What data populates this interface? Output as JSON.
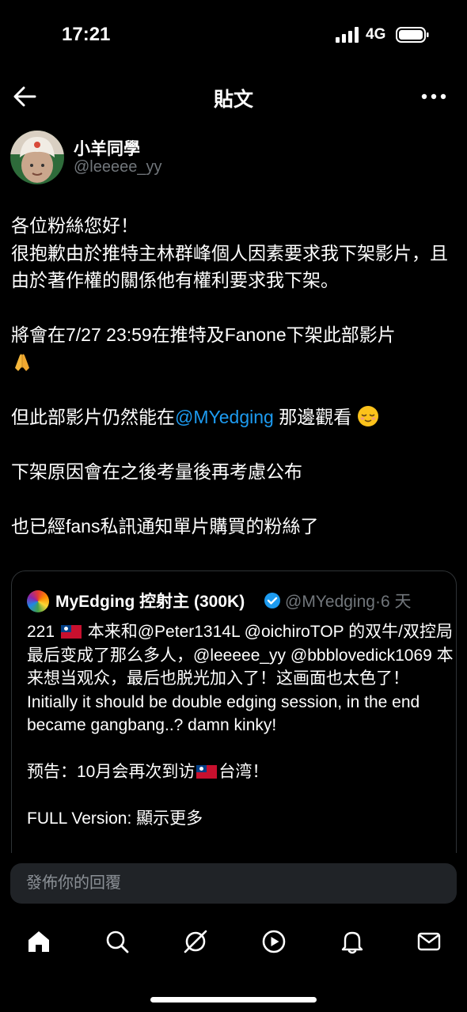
{
  "status": {
    "time": "17:21",
    "network": "4G"
  },
  "header": {
    "title": "貼文"
  },
  "author": {
    "display_name": "小羊同學",
    "handle": "@leeeee_yy"
  },
  "tweet": {
    "line1": "各位粉絲您好！",
    "line2": "很抱歉由於推特主林群峰個人因素要求我下架影片，且由於著作權的關係他有權利要求我下架。",
    "line3": "將會在7/27 23:59在推特及Fanone下架此部影片",
    "line4_before": "但此部影片仍然能在",
    "line4_mention": "@MYedging",
    "line4_after": " 那邊觀看",
    "line5": "下架原因會在之後考量後再考慮公布",
    "line6": "也已經fans私訊通知單片購買的粉絲了"
  },
  "quote": {
    "display_name": "MyEdging 控射主 (300K)",
    "handle": "@MYedging·6 天",
    "p1_prefix": "221",
    "p1_text": " 本来和@Peter1314L @oichiroTOP 的双牛/双控局最后变成了那么多人，@leeeee_yy @bbblovedick1069 本来想当观众，最后也脱光加入了！这画面也太色了！",
    "p2": "Initially it should be double edging session, in the end became gangbang..? damn kinky!",
    "p3_before": "预告：10月会再次到访",
    "p3_after": "台湾！",
    "p4": "FULL Version: 顯示更多"
  },
  "reply": {
    "placeholder": "發佈你的回覆"
  },
  "tabs": [
    "home-icon",
    "search-icon",
    "grok-icon",
    "video-icon",
    "notifications-icon",
    "messages-icon"
  ]
}
